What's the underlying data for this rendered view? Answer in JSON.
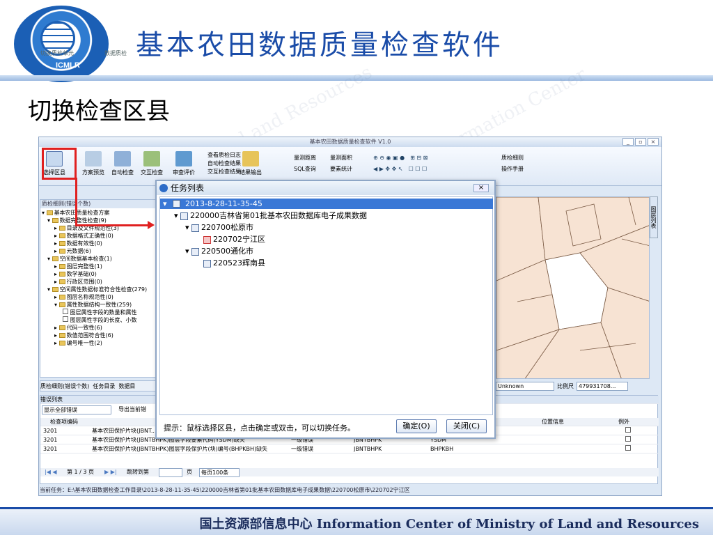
{
  "slide": {
    "title": "基本农田数据质量检查软件",
    "subtitle": "切换检查区县",
    "footer": "国土资源部信息中心  Information Center of Ministry of Land and Resources",
    "logo_text": "ICMLR"
  },
  "app": {
    "title": "基本农田数据质量检查软件 V1.0"
  },
  "ribbon": {
    "buttons": [
      "选择区县",
      "方案预览",
      "自动检查",
      "交互检查",
      "审查评价"
    ],
    "groups": [
      "切换质检单元",
      "数据质检"
    ],
    "menu1": [
      "查看质检日志",
      "自动检查结果",
      "交互检查结果"
    ],
    "export": "结果输出",
    "menu2": [
      "量测距离",
      "量测面积",
      "SQL查询",
      "要素统计"
    ],
    "menu3": [
      "质检细则",
      "操作手册"
    ]
  },
  "left_panel": {
    "header": "质检细则(错误个数)",
    "tree": [
      "基本农田质量检查方案",
      "数据完整性检查(9)",
      "目录及文件规范性(3)",
      "数据格式正确性(0)",
      "数据有效性(0)",
      "元数据(6)",
      "空间数据基本检查(1)",
      "图层完整性(1)",
      "数学基础(0)",
      "行政区范围(0)",
      "空间属性数据标准符合性检查(279)",
      "图层名称规范性(0)",
      "属性数据结构一致性(259)",
      "图层属性字段的数量和属性",
      "图层属性字段的长度、小数",
      "代码一致性(6)",
      "数值范围符合性(6)",
      "编号唯一性(2)"
    ],
    "tabs": [
      "质检细则(错误个数)",
      "任务目录",
      "数据目"
    ]
  },
  "side_tab": "图层列表",
  "status": {
    "unit": "Unknown",
    "scale_label": "比例尺",
    "scale_value": "479931708..."
  },
  "errors": {
    "header": "错误列表",
    "filter": "显示全部错误",
    "export": "导出当前错",
    "columns": [
      "检查项编码",
      "",
      "",
      "",
      "",
      "位置信息",
      "例外"
    ],
    "rows": [
      [
        "3201",
        "基本农田保护片块(JBNT...",
        "",
        "",
        "",
        ""
      ],
      [
        "3201",
        "基本农田保护片块(JBNTBHPK)图层字段要素代码(YSDM)缺失",
        "一级错误",
        "JBNTBHPK",
        "YSDM",
        ""
      ],
      [
        "3201",
        "基本农田保护片块(JBNTBHPK)图层字段保护片(块)编号(BHPKBH)缺失",
        "一级错误",
        "JBNTBHPK",
        "BHPKBH",
        ""
      ]
    ],
    "pager": "第 1 / 3 页",
    "jump": "跳转到第",
    "page_unit": "页",
    "per_page": "每页100条"
  },
  "current_task": "当前任务：E:\\基本农田数据检查工作目录\\2013-8-28-11-35-45\\220000吉林省第01批基本农田数据库电子成果数据\\220700松原市\\220702宁江区",
  "dialog": {
    "title": "任务列表",
    "nodes": [
      "2013-8-28-11-35-45",
      "220000吉林省第01批基本农田数据库电子成果数据",
      "220700松原市",
      "220702宁江区",
      "220500通化市",
      "220523辉南县"
    ],
    "hint": "提示：鼠标选择区县，点击确定或双击，可以切换任务。",
    "ok": "确定(O)",
    "close": "关闭(C)"
  }
}
